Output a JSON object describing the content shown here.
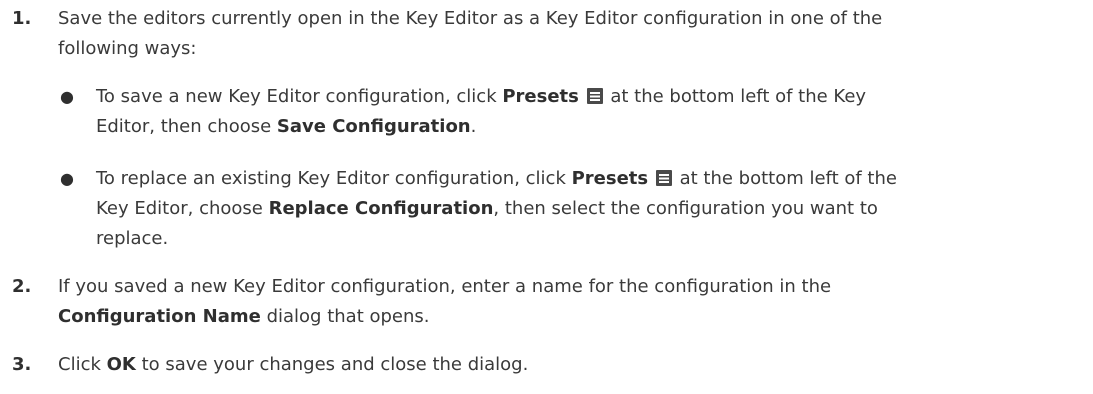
{
  "steps": [
    {
      "number": "1.",
      "line1": "Save the editors currently open in the Key Editor as a Key Editor configuration in one of the",
      "line2": "following ways:",
      "bullets": [
        {
          "dot": "●",
          "l1_pre": "To save a new Key Editor configuration, click ",
          "l1_bold": "Presets",
          "icon": "presets-menu-icon",
          "l1_post": " at the bottom left of the Key",
          "l2_pre": "Editor, then choose ",
          "l2_bold": "Save Configuration",
          "l2_post": "."
        },
        {
          "dot": "●",
          "l1_pre": "To replace an existing Key Editor configuration, click ",
          "l1_bold": "Presets",
          "icon": "presets-menu-icon",
          "l1_post": " at the bottom left of the",
          "l2_pre": "Key Editor, choose ",
          "l2_bold": "Replace Configuration",
          "l2_post": ", then select the configuration you want to",
          "l3": "replace."
        }
      ]
    },
    {
      "number": "2.",
      "line1": "If you saved a new Key Editor configuration, enter a name for the configuration in the",
      "line2_bold": "Configuration Name",
      "line2_post": " dialog that opens."
    },
    {
      "number": "3.",
      "pre": "Click ",
      "bold": "OK",
      "post": " to save your changes and close the dialog."
    }
  ]
}
